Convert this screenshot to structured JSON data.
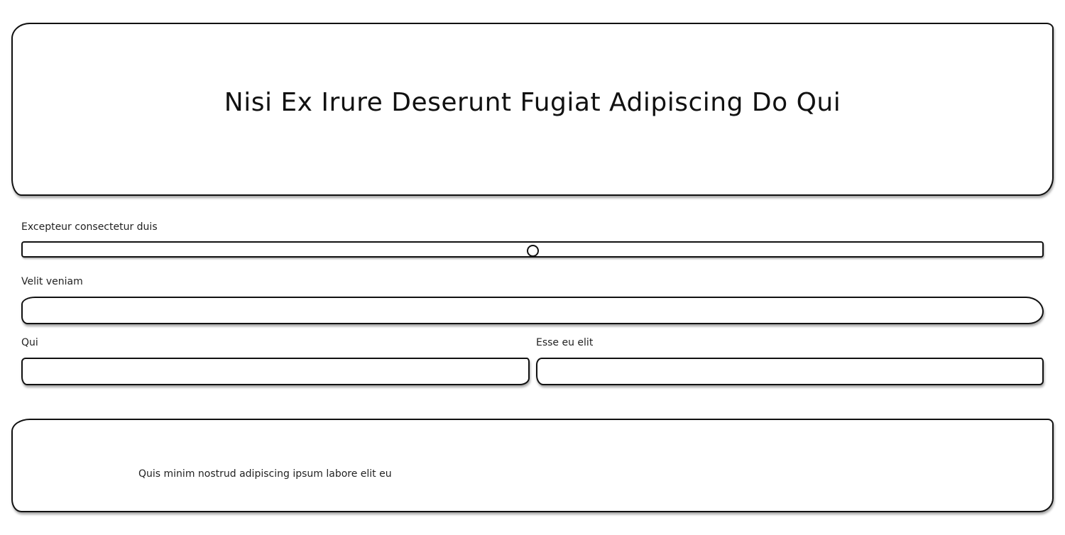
{
  "header": {
    "title": "Nisi Ex Irure Deserunt Fugiat Adipiscing Do Qui"
  },
  "form": {
    "slider": {
      "label": "Excepteur consectetur duis",
      "value_fraction": 0.5
    },
    "velit": {
      "label": "Velit veniam",
      "value": ""
    },
    "qui": {
      "label": "Qui",
      "value": ""
    },
    "esse": {
      "label": "Esse eu elit",
      "value": ""
    }
  },
  "footer": {
    "text": "Quis minim nostrud adipiscing ipsum labore elit eu"
  }
}
